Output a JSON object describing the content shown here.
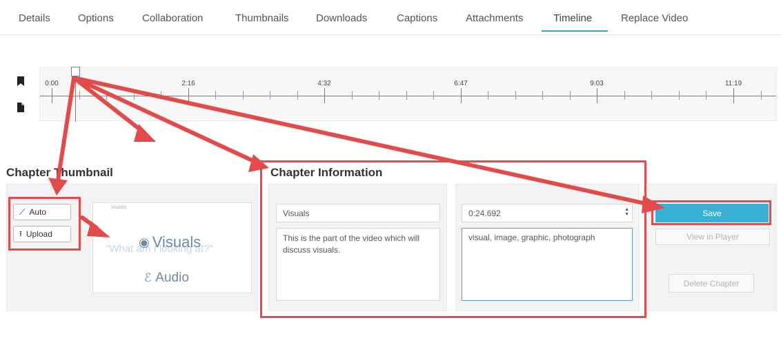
{
  "tabs": [
    {
      "label": "Details"
    },
    {
      "label": "Options"
    },
    {
      "label": "Collaboration"
    },
    {
      "label": "Thumbnails"
    },
    {
      "label": "Downloads"
    },
    {
      "label": "Captions"
    },
    {
      "label": "Attachments"
    },
    {
      "label": "Timeline",
      "active": true
    },
    {
      "label": "Replace Video"
    }
  ],
  "timeline": {
    "tick_labels": [
      "0:00",
      "2:16",
      "4:32",
      "6:47",
      "9:03",
      "11:19"
    ],
    "side_icons": [
      "bookmark-icon",
      "file-icon"
    ]
  },
  "thumbnail": {
    "heading": "Chapter Thumbnail",
    "auto_label": "Auto",
    "upload_label": "Upload",
    "preview": {
      "small_text": "Visuals",
      "title": "Visuals",
      "quote": "\"What am I looking at?\"",
      "audio": "Audio"
    }
  },
  "chapter_info": {
    "heading": "Chapter Information",
    "title_value": "Visuals",
    "description_value": "This is the part of the video which will discuss visuals.",
    "time_value": "0:24.692",
    "keywords_value": "visual, image, graphic, photograph"
  },
  "actions": {
    "save": "Save",
    "view_in_player": "View in Player",
    "delete_chapter": "Delete Chapter"
  },
  "colors": {
    "accent": "#3ab0d4",
    "annotation_red": "#e24b4b",
    "tab_underline": "#3aa0c8"
  }
}
